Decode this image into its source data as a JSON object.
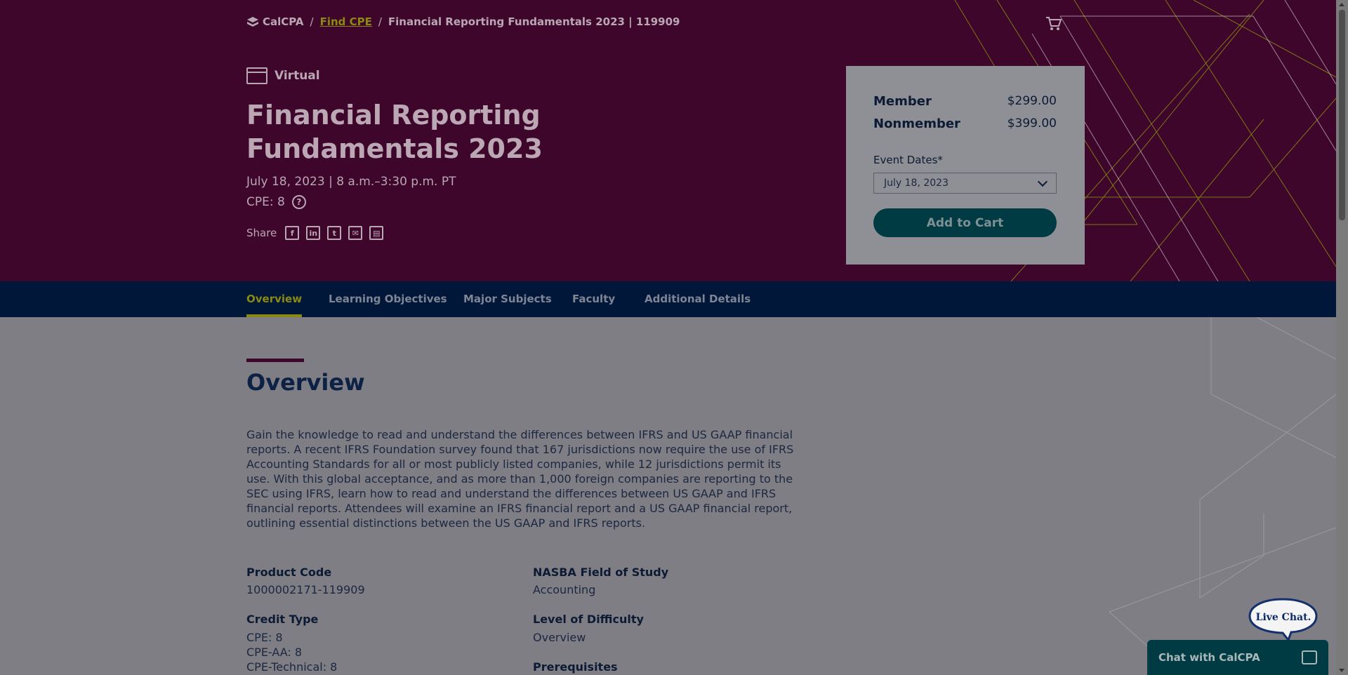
{
  "breadcrumb": {
    "brand": "CalCPA",
    "separator": "/",
    "link": "Find CPE",
    "current": "Financial Reporting Fundamentals 2023 | 119909"
  },
  "event": {
    "format": "Virtual",
    "title": "Financial Reporting Fundamentals 2023",
    "date_time": "July 18, 2023 | 8 a.m.–3:30 p.m. PT",
    "cpe": "CPE: 8",
    "help_glyph": "?",
    "share_label": "Share"
  },
  "pricing": {
    "member_label": "Member",
    "member_price": "$299.00",
    "nonmember_label": "Nonmember",
    "nonmember_price": "$399.00",
    "dates_label": "Event Dates*",
    "dates_selected": "July 18, 2023",
    "add_to_cart": "Add to Cart"
  },
  "tabs": [
    {
      "label": "Overview",
      "active": true
    },
    {
      "label": "Learning Objectives"
    },
    {
      "label": "Major Subjects"
    },
    {
      "label": "Faculty"
    },
    {
      "label": "Additional Details"
    }
  ],
  "overview": {
    "heading": "Overview",
    "body": "Gain the knowledge to read and understand the differences between IFRS and US GAAP financial reports. A recent IFRS Foundation survey found that 167 jurisdictions now require the use of IFRS Accounting Standards for all or most publicly listed companies, while 12 jurisdictions permit its use. With this global acceptance, and as more than 1,000 foreign companies are reporting to the SEC using IFRS, learn how to read and understand the differences between US GAAP and IFRS financial reports. Attendees will examine an IFRS financial report and a US GAAP financial report, outlining essential distinctions between the US GAAP and IFRS reports."
  },
  "details": {
    "product_code_label": "Product Code",
    "product_code": "1000002171-119909",
    "credit_type_label": "Credit Type",
    "credit_types": [
      "CPE: 8",
      "CPE-AA: 8",
      "CPE-Technical: 8"
    ],
    "field_of_study_label": "NASBA Field of Study",
    "field_of_study": "Accounting",
    "difficulty_label": "Level of Difficulty",
    "difficulty": "Overview",
    "prerequisites_label": "Prerequisites"
  },
  "chat": {
    "bubble": "Live Chat.",
    "bar_label": "Chat with CalCPA"
  },
  "colors": {
    "hero_bg": "#3e062b",
    "nav_bg": "#001739",
    "accent": "#8a8a12",
    "button": "#003b43"
  }
}
